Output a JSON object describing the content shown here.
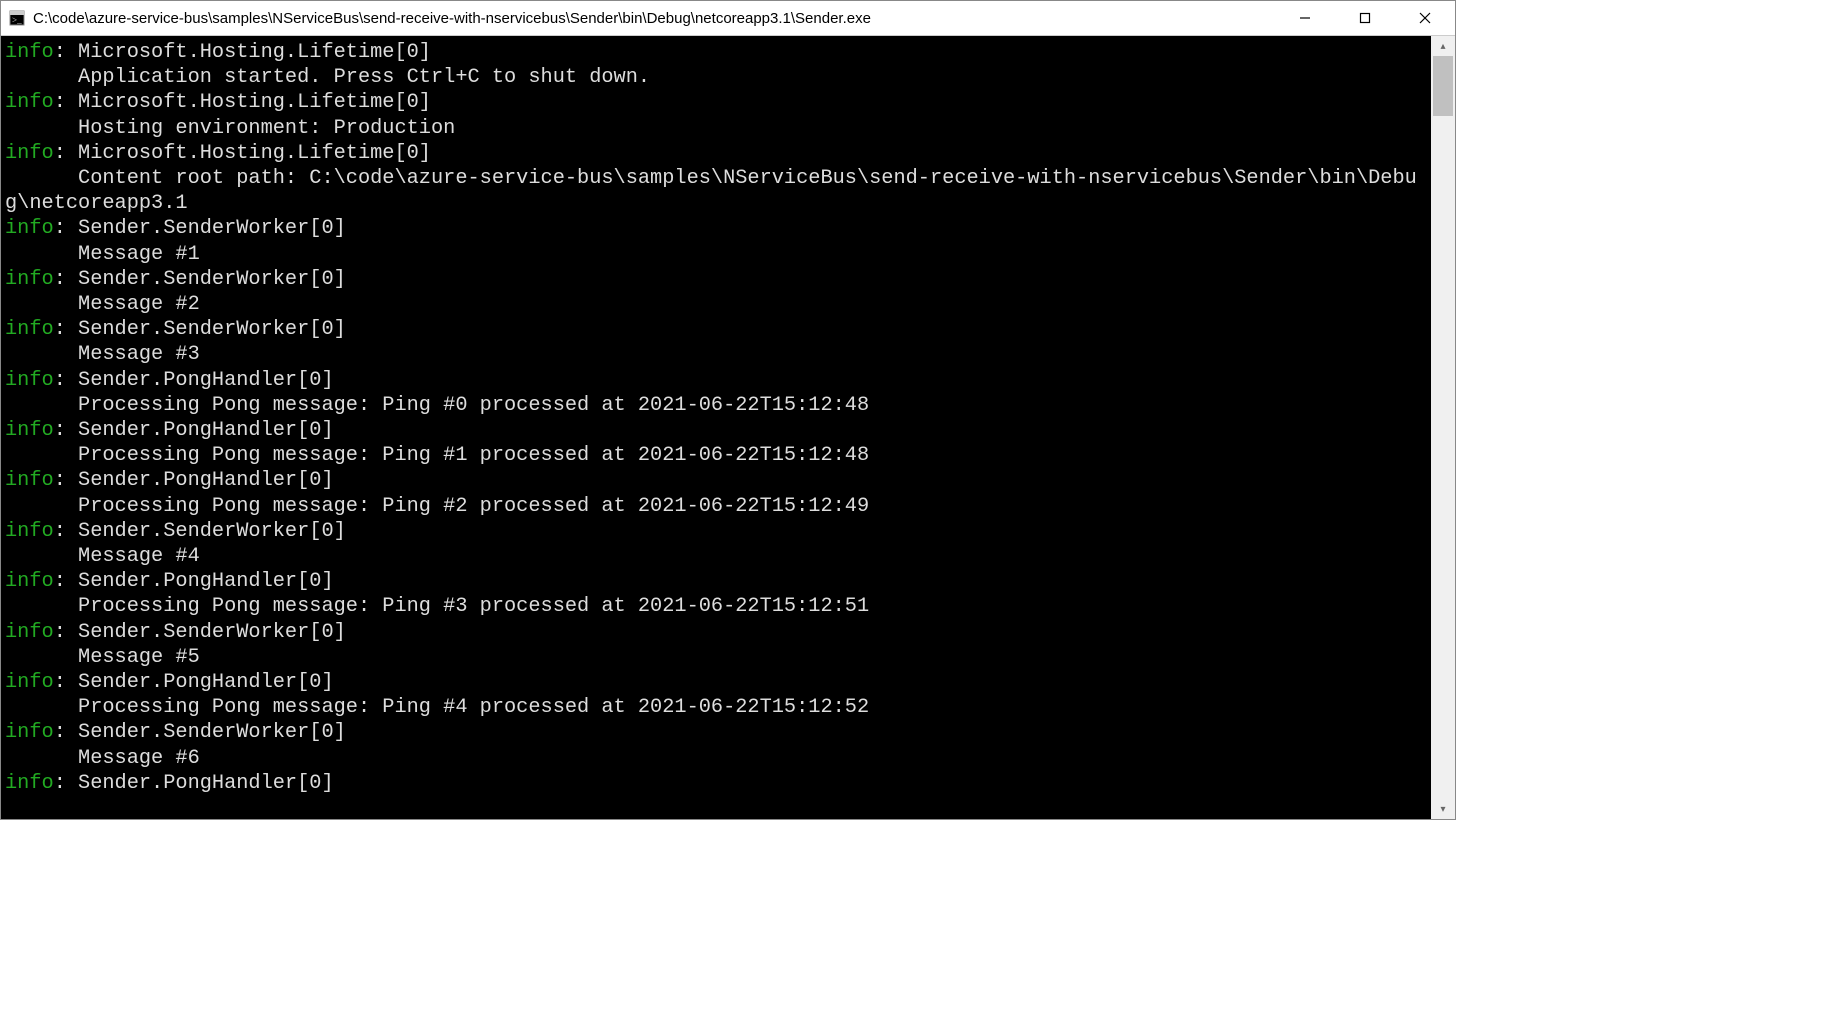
{
  "window": {
    "title": "C:\\code\\azure-service-bus\\samples\\NServiceBus\\send-receive-with-nservicebus\\Sender\\bin\\Debug\\netcoreapp3.1\\Sender.exe"
  },
  "colors": {
    "level_info": "#22aa22",
    "console_bg": "#000000",
    "console_fg": "#dddddd"
  },
  "log": [
    {
      "level": "info",
      "source": "Microsoft.Hosting.Lifetime[0]",
      "body": "Application started. Press Ctrl+C to shut down."
    },
    {
      "level": "info",
      "source": "Microsoft.Hosting.Lifetime[0]",
      "body": "Hosting environment: Production"
    },
    {
      "level": "info",
      "source": "Microsoft.Hosting.Lifetime[0]",
      "body": "Content root path: C:\\code\\azure-service-bus\\samples\\NServiceBus\\send-receive-with-nservicebus\\Sender\\bin\\Debug\\netcoreapp3.1"
    },
    {
      "level": "info",
      "source": "Sender.SenderWorker[0]",
      "body": "Message #1"
    },
    {
      "level": "info",
      "source": "Sender.SenderWorker[0]",
      "body": "Message #2"
    },
    {
      "level": "info",
      "source": "Sender.SenderWorker[0]",
      "body": "Message #3"
    },
    {
      "level": "info",
      "source": "Sender.PongHandler[0]",
      "body": "Processing Pong message: Ping #0 processed at 2021-06-22T15:12:48"
    },
    {
      "level": "info",
      "source": "Sender.PongHandler[0]",
      "body": "Processing Pong message: Ping #1 processed at 2021-06-22T15:12:48"
    },
    {
      "level": "info",
      "source": "Sender.PongHandler[0]",
      "body": "Processing Pong message: Ping #2 processed at 2021-06-22T15:12:49"
    },
    {
      "level": "info",
      "source": "Sender.SenderWorker[0]",
      "body": "Message #4"
    },
    {
      "level": "info",
      "source": "Sender.PongHandler[0]",
      "body": "Processing Pong message: Ping #3 processed at 2021-06-22T15:12:51"
    },
    {
      "level": "info",
      "source": "Sender.SenderWorker[0]",
      "body": "Message #5"
    },
    {
      "level": "info",
      "source": "Sender.PongHandler[0]",
      "body": "Processing Pong message: Ping #4 processed at 2021-06-22T15:12:52"
    },
    {
      "level": "info",
      "source": "Sender.SenderWorker[0]",
      "body": "Message #6"
    },
    {
      "level": "info",
      "source": "Sender.PongHandler[0]",
      "body": ""
    }
  ]
}
